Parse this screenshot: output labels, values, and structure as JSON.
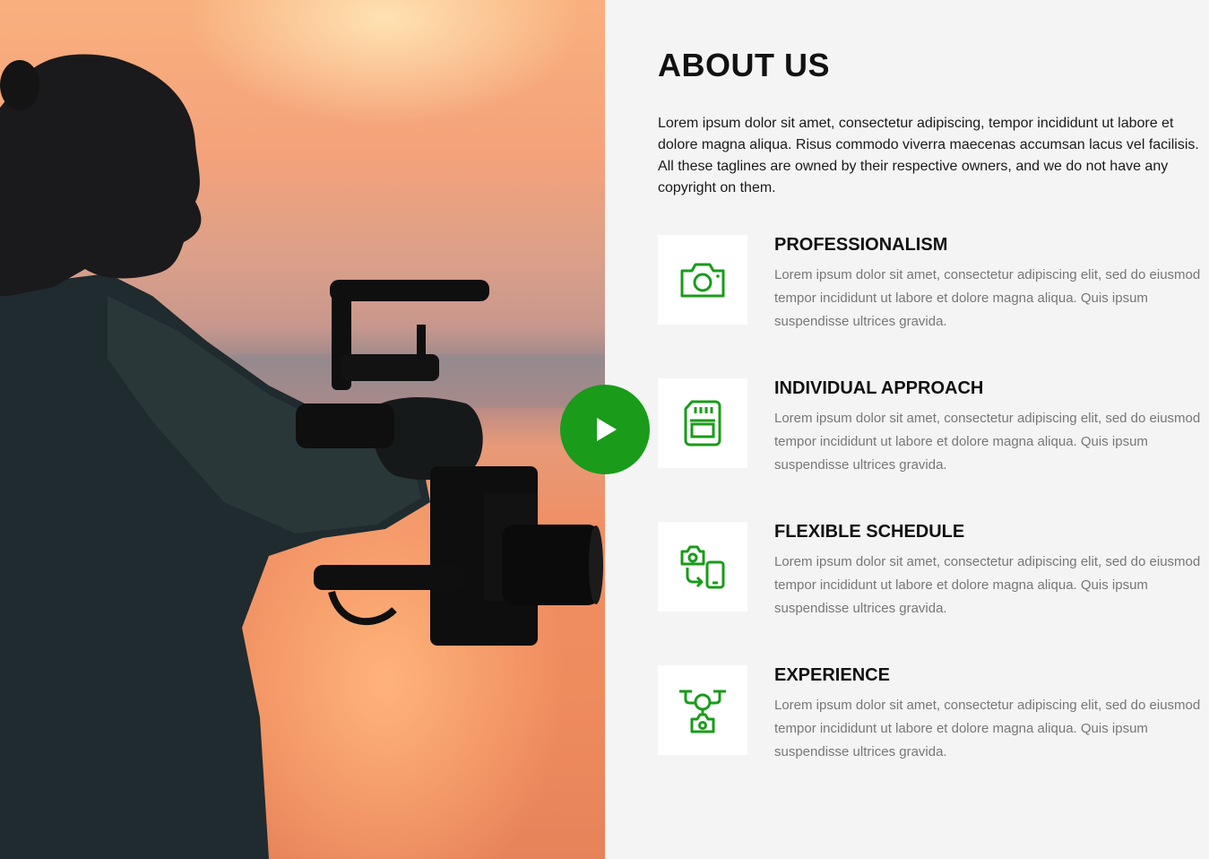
{
  "accent_color": "#1a9b1a",
  "hero": {
    "image_alt": "Silhouette of videographer holding camera gimbal at sunset",
    "play_icon": "play-icon"
  },
  "about": {
    "title": "ABOUT US",
    "intro": "Lorem ipsum dolor sit amet, consectetur adipiscing, tempor incididunt ut labore et dolore magna aliqua. Risus commodo viverra maecenas accumsan lacus vel facilisis. All these taglines are owned by their respective owners, and we do not have any copyright on them."
  },
  "features": [
    {
      "icon": "camera-icon",
      "title": "PROFESSIONALISM",
      "text": "Lorem ipsum dolor sit amet, consectetur adipiscing elit, sed do eiusmod tempor incididunt ut labore et dolore magna aliqua. Quis ipsum suspendisse ultrices gravida."
    },
    {
      "icon": "sd-card-icon",
      "title": "INDIVIDUAL APPROACH",
      "text": "Lorem ipsum dolor sit amet, consectetur adipiscing elit, sed do eiusmod tempor incididunt ut labore et dolore magna aliqua. Quis ipsum suspendisse ultrices gravida."
    },
    {
      "icon": "camera-to-phone-transfer-icon",
      "title": "FLEXIBLE SCHEDULE",
      "text": "Lorem ipsum dolor sit amet, consectetur adipiscing elit, sed do eiusmod tempor incididunt ut labore et dolore magna aliqua. Quis ipsum suspendisse ultrices gravida."
    },
    {
      "icon": "camera-drone-icon",
      "title": "EXPERIENCE",
      "text": "Lorem ipsum dolor sit amet, consectetur adipiscing elit, sed do eiusmod tempor incididunt ut labore et dolore magna aliqua. Quis ipsum suspendisse ultrices gravida."
    }
  ]
}
